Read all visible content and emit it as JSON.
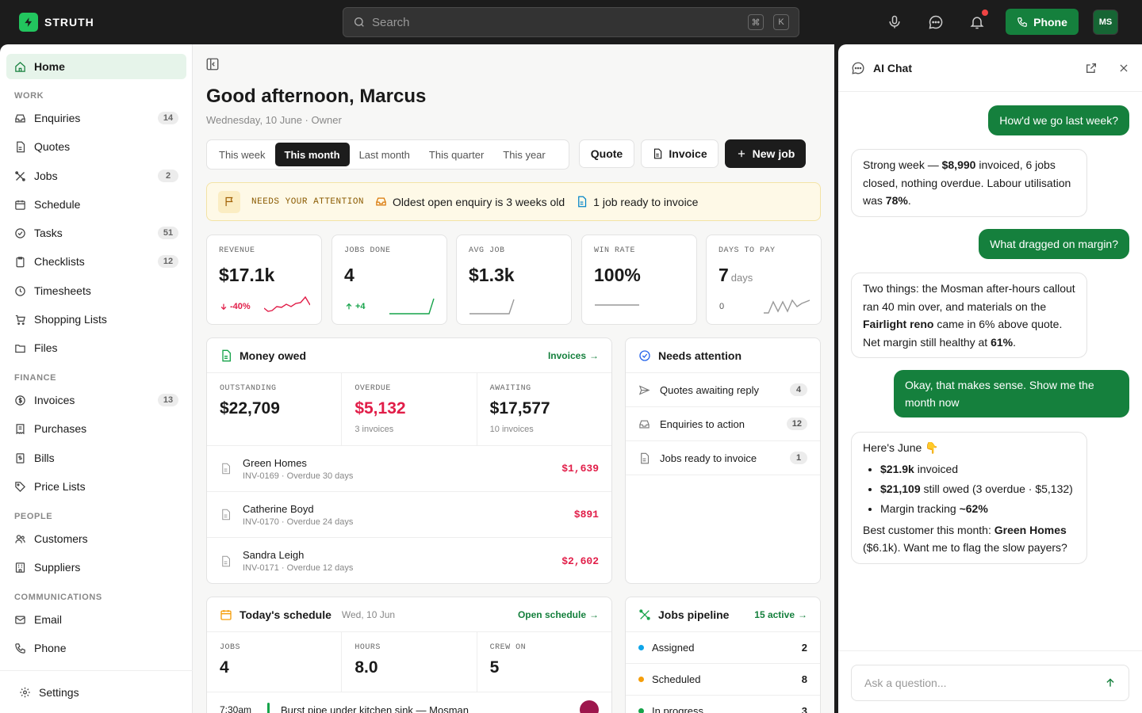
{
  "app": {
    "name": "STRUTH"
  },
  "topbar": {
    "search_placeholder": "Search",
    "kbd_1": "⌘",
    "kbd_2": "K",
    "phone_label": "Phone",
    "avatar_initials": "MS"
  },
  "sidebar": {
    "home": "Home",
    "sections": {
      "work": "WORK",
      "finance": "FINANCE",
      "people": "PEOPLE",
      "comms": "COMMUNICATIONS"
    },
    "work": [
      {
        "label": "Enquiries",
        "badge": "14"
      },
      {
        "label": "Quotes",
        "badge": ""
      },
      {
        "label": "Jobs",
        "badge": "2"
      },
      {
        "label": "Schedule",
        "badge": ""
      },
      {
        "label": "Tasks",
        "badge": "51"
      },
      {
        "label": "Checklists",
        "badge": "12"
      },
      {
        "label": "Timesheets",
        "badge": ""
      },
      {
        "label": "Shopping Lists",
        "badge": ""
      },
      {
        "label": "Files",
        "badge": ""
      }
    ],
    "finance": [
      {
        "label": "Invoices",
        "badge": "13"
      },
      {
        "label": "Purchases",
        "badge": ""
      },
      {
        "label": "Bills",
        "badge": ""
      },
      {
        "label": "Price Lists",
        "badge": ""
      }
    ],
    "people": [
      {
        "label": "Customers"
      },
      {
        "label": "Suppliers"
      }
    ],
    "comms": [
      {
        "label": "Email"
      },
      {
        "label": "Phone"
      }
    ],
    "settings": "Settings"
  },
  "main": {
    "greeting": "Good afternoon, Marcus",
    "subline": "Wednesday, 10 June · Owner",
    "periods": [
      "This week",
      "This month",
      "Last month",
      "This quarter",
      "This year"
    ],
    "active_period": "This month",
    "actions": {
      "quote": "Quote",
      "invoice": "Invoice",
      "new_job": "New job"
    },
    "banner": {
      "label": "NEEDS YOUR ATTENTION",
      "item1": "Oldest open enquiry is 3 weeks old",
      "item2": "1 job ready to invoice"
    },
    "stats": [
      {
        "label": "REVENUE",
        "value": "$17.1k",
        "unit": "",
        "delta": "-40%",
        "delta_dir": "down",
        "color": "#e11d48"
      },
      {
        "label": "JOBS DONE",
        "value": "4",
        "unit": "",
        "delta": "+4",
        "delta_dir": "up",
        "color": "#16a34a"
      },
      {
        "label": "AVG JOB",
        "value": "$1.3k",
        "unit": "",
        "delta": "",
        "color": "#999999"
      },
      {
        "label": "WIN RATE",
        "value": "100%",
        "unit": "",
        "delta": "",
        "color": "#999999"
      },
      {
        "label": "DAYS TO PAY",
        "value": "7",
        "unit": "days",
        "delta": "0",
        "color": "#999999"
      }
    ],
    "money_owed": {
      "title": "Money owed",
      "link": "Invoices",
      "outstanding": {
        "label": "OUTSTANDING",
        "value": "$22,709"
      },
      "overdue": {
        "label": "OVERDUE",
        "value": "$5,132",
        "sub": "3 invoices"
      },
      "awaiting": {
        "label": "AWAITING",
        "value": "$17,577",
        "sub": "10 invoices"
      },
      "invoices": [
        {
          "name": "Green Homes",
          "meta": "INV-0169 · Overdue 30 days",
          "amount": "$1,639"
        },
        {
          "name": "Catherine Boyd",
          "meta": "INV-0170 · Overdue 24 days",
          "amount": "$891"
        },
        {
          "name": "Sandra Leigh",
          "meta": "INV-0171 · Overdue 12 days",
          "amount": "$2,602"
        }
      ]
    },
    "needs_attention": {
      "title": "Needs attention",
      "items": [
        {
          "label": "Quotes awaiting reply",
          "count": "4"
        },
        {
          "label": "Enquiries to action",
          "count": "12"
        },
        {
          "label": "Jobs ready to invoice",
          "count": "1"
        }
      ]
    },
    "schedule": {
      "title": "Today's schedule",
      "date": "Wed, 10 Jun",
      "link": "Open schedule",
      "jobs": {
        "label": "JOBS",
        "value": "4"
      },
      "hours": {
        "label": "HOURS",
        "value": "8.0"
      },
      "crew": {
        "label": "CREW ON",
        "value": "5"
      },
      "first_time": "7:30am",
      "first_job": "Burst pipe under kitchen sink — Mosman"
    },
    "pipeline": {
      "title": "Jobs pipeline",
      "link": "15 active",
      "rows": [
        {
          "label": "Assigned",
          "count": "2",
          "color": "#0ea5e9"
        },
        {
          "label": "Scheduled",
          "count": "8",
          "color": "#f59e0b"
        },
        {
          "label": "In progress",
          "count": "3",
          "color": "#16a34a"
        }
      ]
    }
  },
  "chat": {
    "title": "AI Chat",
    "m1": "How'd we go last week?",
    "a1": {
      "p1": "Strong week — ",
      "b1": "$8,990",
      "p2": " invoiced, 6 jobs closed, nothing overdue. Labour utilisation was ",
      "b2": "78%",
      "p3": "."
    },
    "m2": "What dragged on margin?",
    "a2": {
      "p1": "Two things: the Mosman after-hours callout ran 40 min over, and materials on the ",
      "b1": "Fairlight reno",
      "p2": " came in 6% above quote. Net margin still healthy at ",
      "b2": "61%",
      "p3": "."
    },
    "m3": "Okay, that makes sense. Show me the month now",
    "a3": {
      "intro": "Here's June 👇",
      "b1": "$21.9k",
      "t1": " invoiced",
      "b2": "$21,109",
      "t2": " still owed (3 overdue · $5,132)",
      "t3": "Margin tracking ",
      "b3": "~62%",
      "p1": "Best customer this month: ",
      "b4": "Green Homes",
      "p2": " ($6.1k). Want me to flag the slow payers?"
    },
    "input_placeholder": "Ask a question..."
  }
}
